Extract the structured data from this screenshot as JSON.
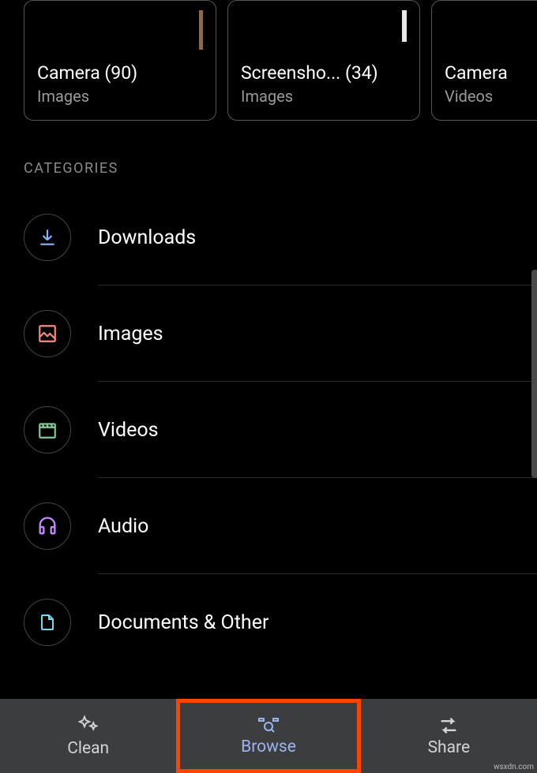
{
  "folders": [
    {
      "name": "Camera",
      "count": 90,
      "type": "Images"
    },
    {
      "name": "Screensho...",
      "count": 34,
      "type": "Images"
    },
    {
      "name": "Camera",
      "count": null,
      "type": "Videos"
    }
  ],
  "categories_header": "CATEGORIES",
  "categories": [
    {
      "label": "Downloads",
      "icon": "download"
    },
    {
      "label": "Images",
      "icon": "image"
    },
    {
      "label": "Videos",
      "icon": "video"
    },
    {
      "label": "Audio",
      "icon": "audio"
    },
    {
      "label": "Documents & Other",
      "icon": "document"
    }
  ],
  "nav": [
    {
      "label": "Clean",
      "icon": "sparkle"
    },
    {
      "label": "Browse",
      "icon": "browse"
    },
    {
      "label": "Share",
      "icon": "share"
    }
  ],
  "watermark": "wsxdn.com",
  "colors": {
    "download": "#8ab4f8",
    "image": "#f28b82",
    "video": "#81c995",
    "audio": "#c58af9",
    "document": "#78d9ec",
    "highlight": "#ff4400",
    "browse": "#9fb4ef"
  }
}
